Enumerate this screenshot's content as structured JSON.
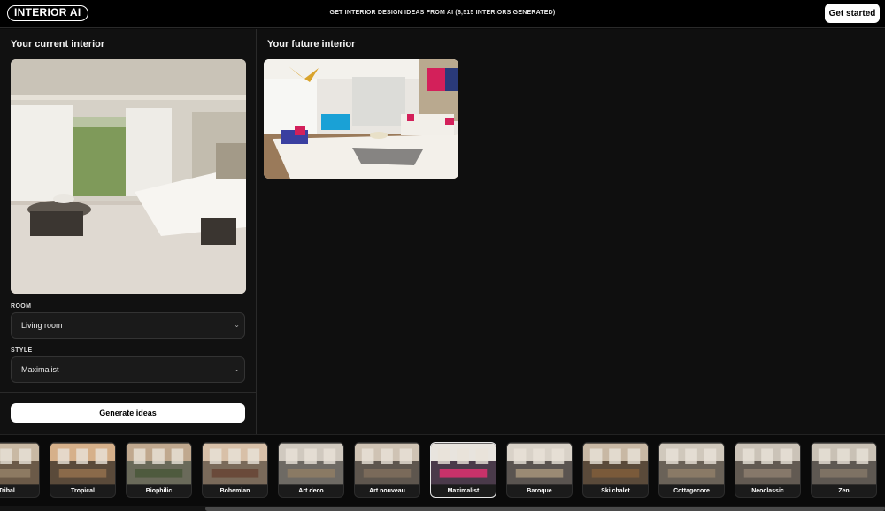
{
  "header": {
    "logo": "INTERIOR AI",
    "tagline": "GET INTERIOR DESIGN IDEAS FROM AI (6,515 INTERIORS GENERATED)",
    "cta": "Get started"
  },
  "current": {
    "title": "Your current interior"
  },
  "future": {
    "title": "Your future interior"
  },
  "form": {
    "room_label": "ROOM",
    "room_value": "Living room",
    "style_label": "STYLE",
    "style_value": "Maximalist",
    "generate": "Generate ideas"
  },
  "styles": [
    {
      "label": "Tribal"
    },
    {
      "label": "Tropical"
    },
    {
      "label": "Biophilic"
    },
    {
      "label": "Bohemian"
    },
    {
      "label": "Art deco"
    },
    {
      "label": "Art nouveau"
    },
    {
      "label": "Maximalist",
      "active": true
    },
    {
      "label": "Baroque"
    },
    {
      "label": "Ski chalet"
    },
    {
      "label": "Cottagecore"
    },
    {
      "label": "Neoclassic"
    },
    {
      "label": "Zen"
    }
  ]
}
